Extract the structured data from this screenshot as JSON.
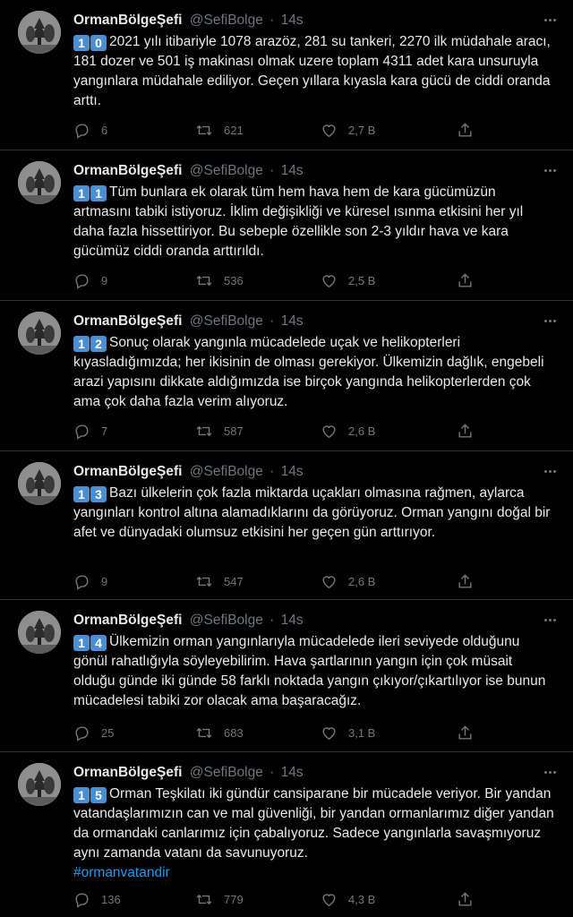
{
  "colors": {
    "background": "#000000",
    "text": "#e7e9ea",
    "muted": "#71767b",
    "accent": "#1d9bf0",
    "keycap": "#4a8fd4",
    "divider": "#2f3336"
  },
  "icons": {
    "reply": "speech-bubble-icon",
    "retweet": "retweet-arrows-icon",
    "like": "heart-icon",
    "share": "share-upload-icon",
    "more": "ellipsis-icon"
  },
  "tweets": [
    {
      "name": "OrmanBölgeŞefi",
      "handle": "@SefiBolge",
      "dot": "·",
      "time": "14s",
      "digits": [
        "1",
        "0"
      ],
      "text": "2021 yılı itibariyle 1078 arazöz, 281 su tankeri, 2270 ilk müdahale aracı, 181 dozer ve 501 iş makinası olmak uzere toplam 4311 adet kara unsuruyla yangınlara müdahale ediliyor. Geçen yıllara kıyasla kara gücü de ciddi oranda arttı.",
      "hashtag": "",
      "replies": "6",
      "retweets": "621",
      "likes": "2,7 B"
    },
    {
      "name": "OrmanBölgeŞefi",
      "handle": "@SefiBolge",
      "dot": "·",
      "time": "14s",
      "digits": [
        "1",
        "1"
      ],
      "text": "Tüm bunlara ek olarak tüm hem hava hem de kara gücümüzün artmasını tabiki istiyoruz. İklim değişikliği ve küresel ısınma etkisini her yıl daha fazla hissettiriyor. Bu sebeple özellikle son 2-3 yıldır hava ve kara gücümüz ciddi oranda arttırıldı.",
      "hashtag": "",
      "replies": "9",
      "retweets": "536",
      "likes": "2,5 B"
    },
    {
      "name": "OrmanBölgeŞefi",
      "handle": "@SefiBolge",
      "dot": "·",
      "time": "14s",
      "digits": [
        "1",
        "2"
      ],
      "text": "Sonuç olarak yangınla mücadelede uçak ve helikopterleri kıyasladığımızda; her ikisinin de olması gerekiyor. Ülkemizin dağlık, engebeli arazi yapısını dikkate aldığımızda ise birçok yangında helikopterlerden çok ama çok daha fazla verim alıyoruz.",
      "hashtag": "",
      "replies": "7",
      "retweets": "587",
      "likes": "2,6 B"
    },
    {
      "name": "OrmanBölgeŞefi",
      "handle": "@SefiBolge",
      "dot": "·",
      "time": "14s",
      "digits": [
        "1",
        "3"
      ],
      "text": "Bazı ülkelerin çok fazla miktarda uçakları olmasına rağmen, aylarca yangınları kontrol altına alamadıklarını da görüyoruz. Orman yangını doğal bir afet ve dünyadaki olumsuz etkisini her geçen gün arttırıyor.",
      "hashtag": "",
      "replies": "9",
      "retweets": "547",
      "likes": "2,6 B"
    },
    {
      "name": "OrmanBölgeŞefi",
      "handle": "@SefiBolge",
      "dot": "·",
      "time": "14s",
      "digits": [
        "1",
        "4"
      ],
      "text": "Ülkemizin orman yangınlarıyla mücadelede ileri seviyede olduğunu gönül rahatlığıyla söyleyebilirim. Hava şartlarının yangın için çok müsait olduğu günde iki günde 58 farklı noktada yangın çıkıyor/çıkartılıyor ise bunun mücadelesi tabiki zor olacak ama başaracağız.",
      "hashtag": "",
      "replies": "25",
      "retweets": "683",
      "likes": "3,1 B"
    },
    {
      "name": "OrmanBölgeŞefi",
      "handle": "@SefiBolge",
      "dot": "·",
      "time": "14s",
      "digits": [
        "1",
        "5"
      ],
      "text": "Orman Teşkilatı iki gündür cansiparane bir mücadele veriyor. Bir yandan vatandaşlarımızın can ve mal güvenliği, bir yandan ormanlarımız diğer yandan da ormandaki canlarımız için çabalıyoruz. Sadece yangınlarla savaşmıyoruz aynı zamanda vatanı da savunuyoruz.",
      "hashtag": "#ormanvatandir",
      "replies": "136",
      "retweets": "779",
      "likes": "4,3 B"
    }
  ]
}
